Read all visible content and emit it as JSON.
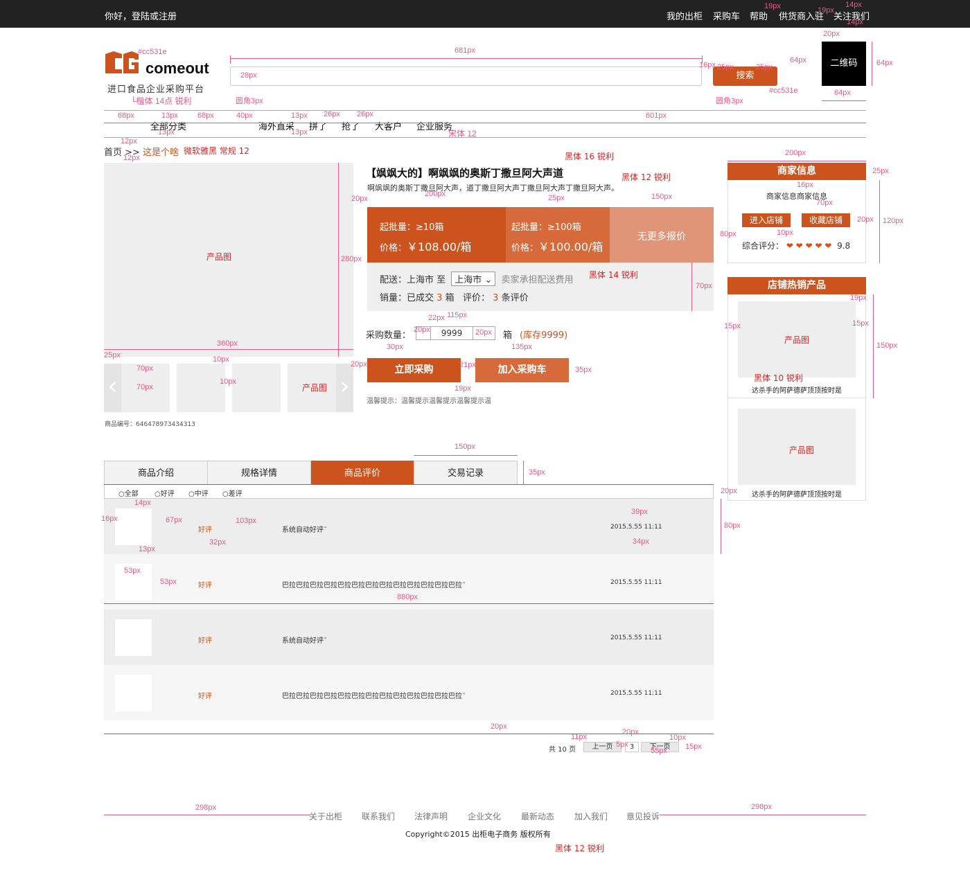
{
  "topbar": {
    "greeting": "你好，登陆或注册",
    "links": [
      "我的出柜",
      "采购车",
      "帮助",
      "供货商入驻",
      "关注我们"
    ]
  },
  "header": {
    "logo_text": "comeout",
    "slogan": "进口食品企业采购平台",
    "search_button": "搜索",
    "qr_label": "二维码"
  },
  "category_nav": {
    "all": "全部分类",
    "items": [
      "海外直采",
      "拼了",
      "抢了",
      "大客户",
      "企业服务"
    ]
  },
  "breadcrumb": {
    "home": "首页",
    "separator": ">>",
    "current": "这是个啥"
  },
  "product": {
    "image_label": "产品图",
    "thumb_label": "产品图",
    "sku": "商品编号：646478973434313",
    "title": "【飒飒大的】啊飒飒的奥斯丁撒旦阿大声道",
    "subtitle": "啊飒飒的奥斯丁撒旦阿大声，道丁撒旦阿大声丁撒旦阿大声丁撒旦阿大声。",
    "tiers": [
      {
        "min_label": "起批量：≥10箱",
        "price_label": "价格：",
        "price": "￥108.00/箱"
      },
      {
        "min_label": "起批量：≥100箱",
        "price_label": "价格：",
        "price": "￥100.00/箱"
      }
    ],
    "more_quote": "无更多报价",
    "ship_label": "配送：上海市  至",
    "ship_city": "上海市",
    "ship_note": "卖家承担配送费用",
    "sales_prefix": "销量：已成交",
    "sales_count": "3",
    "sales_unit": "箱",
    "review_prefix": "评价：",
    "review_count": "3",
    "review_unit": "条评价",
    "qty_label": "采购数量：",
    "qty_value": "9999",
    "qty_unit": "箱",
    "stock": "(库存9999)",
    "buy_button": "立即采购",
    "cart_button": "加入采购车",
    "tip": "温馨提示：温馨提示温馨提示温馨提示温"
  },
  "merchant": {
    "heading": "商家信息",
    "name": "商家信息商家信息",
    "enter_shop": "进入店铺",
    "fav_shop": "收藏店铺",
    "rating_label": "综合评分：",
    "rating_value": "9.8",
    "rating_hearts": 5
  },
  "hot": {
    "heading": "店铺热销产品",
    "items": [
      {
        "image_label": "产品图",
        "caption": "达杀手的阿萨德萨顶顶按时是"
      },
      {
        "image_label": "产品图",
        "caption": "达杀手的阿萨德萨顶顶按时是"
      }
    ]
  },
  "tabs": [
    "商品介绍",
    "规格详情",
    "商品评价",
    "交易记录"
  ],
  "active_tab": 2,
  "filters": [
    "全部",
    "好评",
    "中评",
    "差评"
  ],
  "reviews": [
    {
      "rating": "好评",
      "text": "系统自动好评˜",
      "date": "2015.5.55    11:11"
    },
    {
      "rating": "好评",
      "text": "巴拉巴拉巴拉巴拉巴拉巴拉巴拉巴拉巴拉巴拉巴拉巴拉巴拉˜",
      "date": "2015.5.55    11:11"
    },
    {
      "rating": "好评",
      "text": "系统自动好评˜",
      "date": "2015.5.55    11:11"
    },
    {
      "rating": "好评",
      "text": "巴拉巴拉巴拉巴拉巴拉巴拉巴拉巴拉巴拉巴拉巴拉巴拉巴拉˜",
      "date": "2015.5.55    11:11"
    }
  ],
  "pager": {
    "total": "共 10 页",
    "prev": "上一页",
    "current": "3",
    "next": "下一页"
  },
  "footer": {
    "links": [
      "关于出柜",
      "联系我们",
      "法律声明",
      "企业文化",
      "最新动态",
      "加入我们",
      "意见投诉"
    ],
    "copyright": "Copyright©2015    出柜电子商务 版权所有"
  },
  "annotations": {
    "color_code": "#cc531e",
    "kaiti": "└楷体 14点 锐利",
    "radius": "圆角3px",
    "songti": "宋体 12",
    "ms_yahei": "微软雅黑  常规 12",
    "heiti16": "黑体 16 锐利",
    "heiti12": "黑体 12 锐利",
    "heiti14": "黑体 14 锐利",
    "heiti10": "黑体 10 锐利",
    "heiti12_footer": "黑体 12 锐利",
    "px_labels": [
      "681px",
      "28px",
      "16px",
      "25px",
      "25px",
      "64px",
      "64px",
      "64px",
      "20px",
      "19px",
      "19px",
      "14px",
      "14px",
      "68px",
      "13px",
      "68px",
      "40px",
      "13px",
      "26px",
      "26px",
      "601px",
      "13px",
      "13px",
      "12px",
      "12px",
      "280px",
      "360px",
      "25px",
      "70px",
      "70px",
      "10px",
      "10px",
      "20px",
      "200px",
      "25px",
      "150px",
      "80px",
      "70px",
      "22px",
      "115px",
      "20px",
      "20px",
      "30px",
      "135px",
      "20px",
      "21px",
      "19px",
      "35px",
      "200px",
      "25px",
      "16px",
      "70px",
      "20px",
      "120px",
      "10px",
      "19px",
      "15px",
      "15px",
      "150px",
      "150px",
      "35px",
      "20px",
      "14px",
      "16px",
      "67px",
      "103px",
      "39px",
      "80px",
      "32px",
      "34px",
      "13px",
      "53px",
      "53px",
      "880px",
      "20px",
      "11px",
      "20px",
      "10px",
      "5px",
      "55px",
      "15px",
      "298px",
      "298px"
    ]
  }
}
